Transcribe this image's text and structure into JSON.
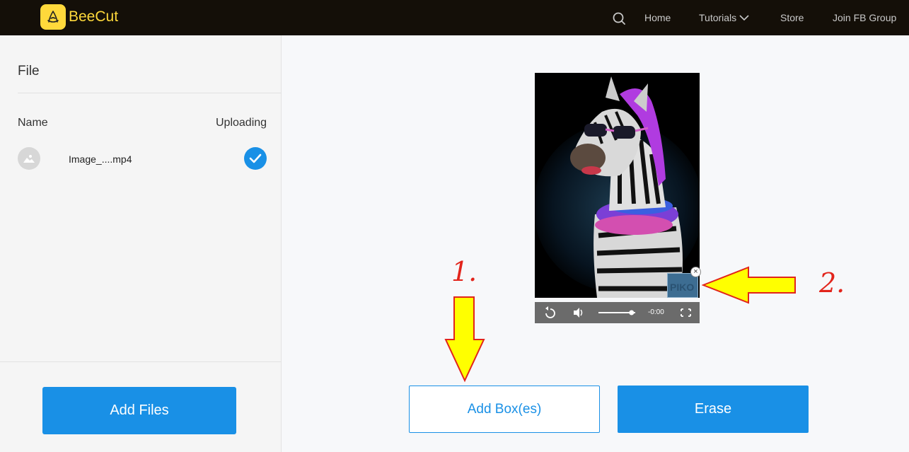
{
  "header": {
    "brand": "BeeCut",
    "nav": {
      "home": "Home",
      "tutorials": "Tutorials",
      "store": "Store",
      "fb": "Join FB Group"
    }
  },
  "left_panel": {
    "title": "File",
    "columns": {
      "name": "Name",
      "status": "Uploading"
    },
    "files": [
      {
        "name": "Image_....mp4",
        "status_icon": "check-circle-icon"
      }
    ],
    "add_files_label": "Add Files"
  },
  "player": {
    "time": "-0:00",
    "volume_level": 0.9,
    "overlay_close": "×"
  },
  "annotations": {
    "step1": "1.",
    "step2": "2."
  },
  "actions": {
    "add_box_label": "Add Box(es)",
    "erase_label": "Erase"
  },
  "colors": {
    "brand": "#ffd93b",
    "accent": "#1990e6",
    "annotation": "#e2241b",
    "arrow_fill": "#ffff00"
  }
}
